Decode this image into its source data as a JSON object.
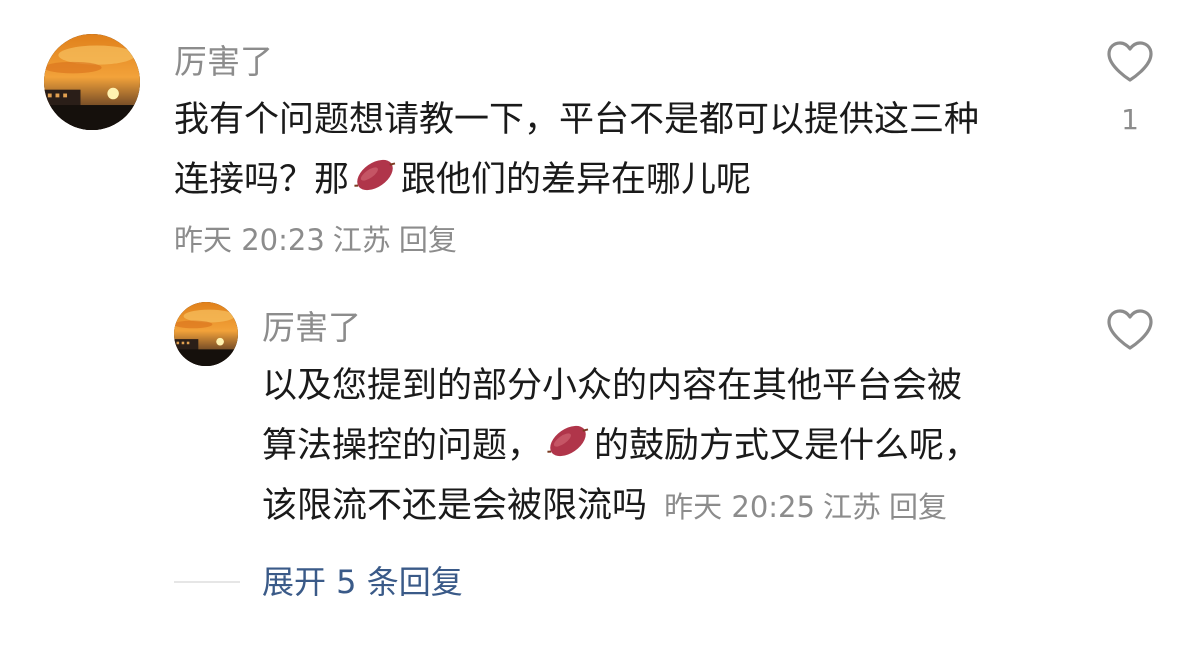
{
  "comments": [
    {
      "username": "厉害了",
      "content_lines": [
        [
          "我有个问题想请教一下，平台不是都可以提供这三种"
        ],
        [
          "连接吗？那",
          "sweet-potato-emoji",
          "跟他们的差异在哪儿呢"
        ]
      ],
      "time": "昨天 20:23",
      "location": "江苏",
      "reply_label": "回复",
      "like_count": "1",
      "like_icon": "heart-outline-icon"
    }
  ],
  "replies": [
    {
      "username": "厉害了",
      "content_lines": [
        [
          "以及您提到的部分小众的内容在其他平台会被"
        ],
        [
          "算法操控的问题，",
          "sweet-potato-emoji",
          "的鼓励方式又是什么呢，"
        ],
        [
          "该限流不还是会被限流吗"
        ]
      ],
      "time": "昨天 20:25",
      "location": "江苏",
      "reply_label": "回复",
      "like_icon": "heart-outline-icon"
    }
  ],
  "expand_replies": {
    "label": "展开 5 条回复"
  },
  "colors": {
    "text_primary": "#1a1a1a",
    "text_secondary": "#8c8c8c",
    "link": "#3a5a88",
    "divider": "#e6e6e6",
    "emoji_skin": "#b0354a"
  }
}
